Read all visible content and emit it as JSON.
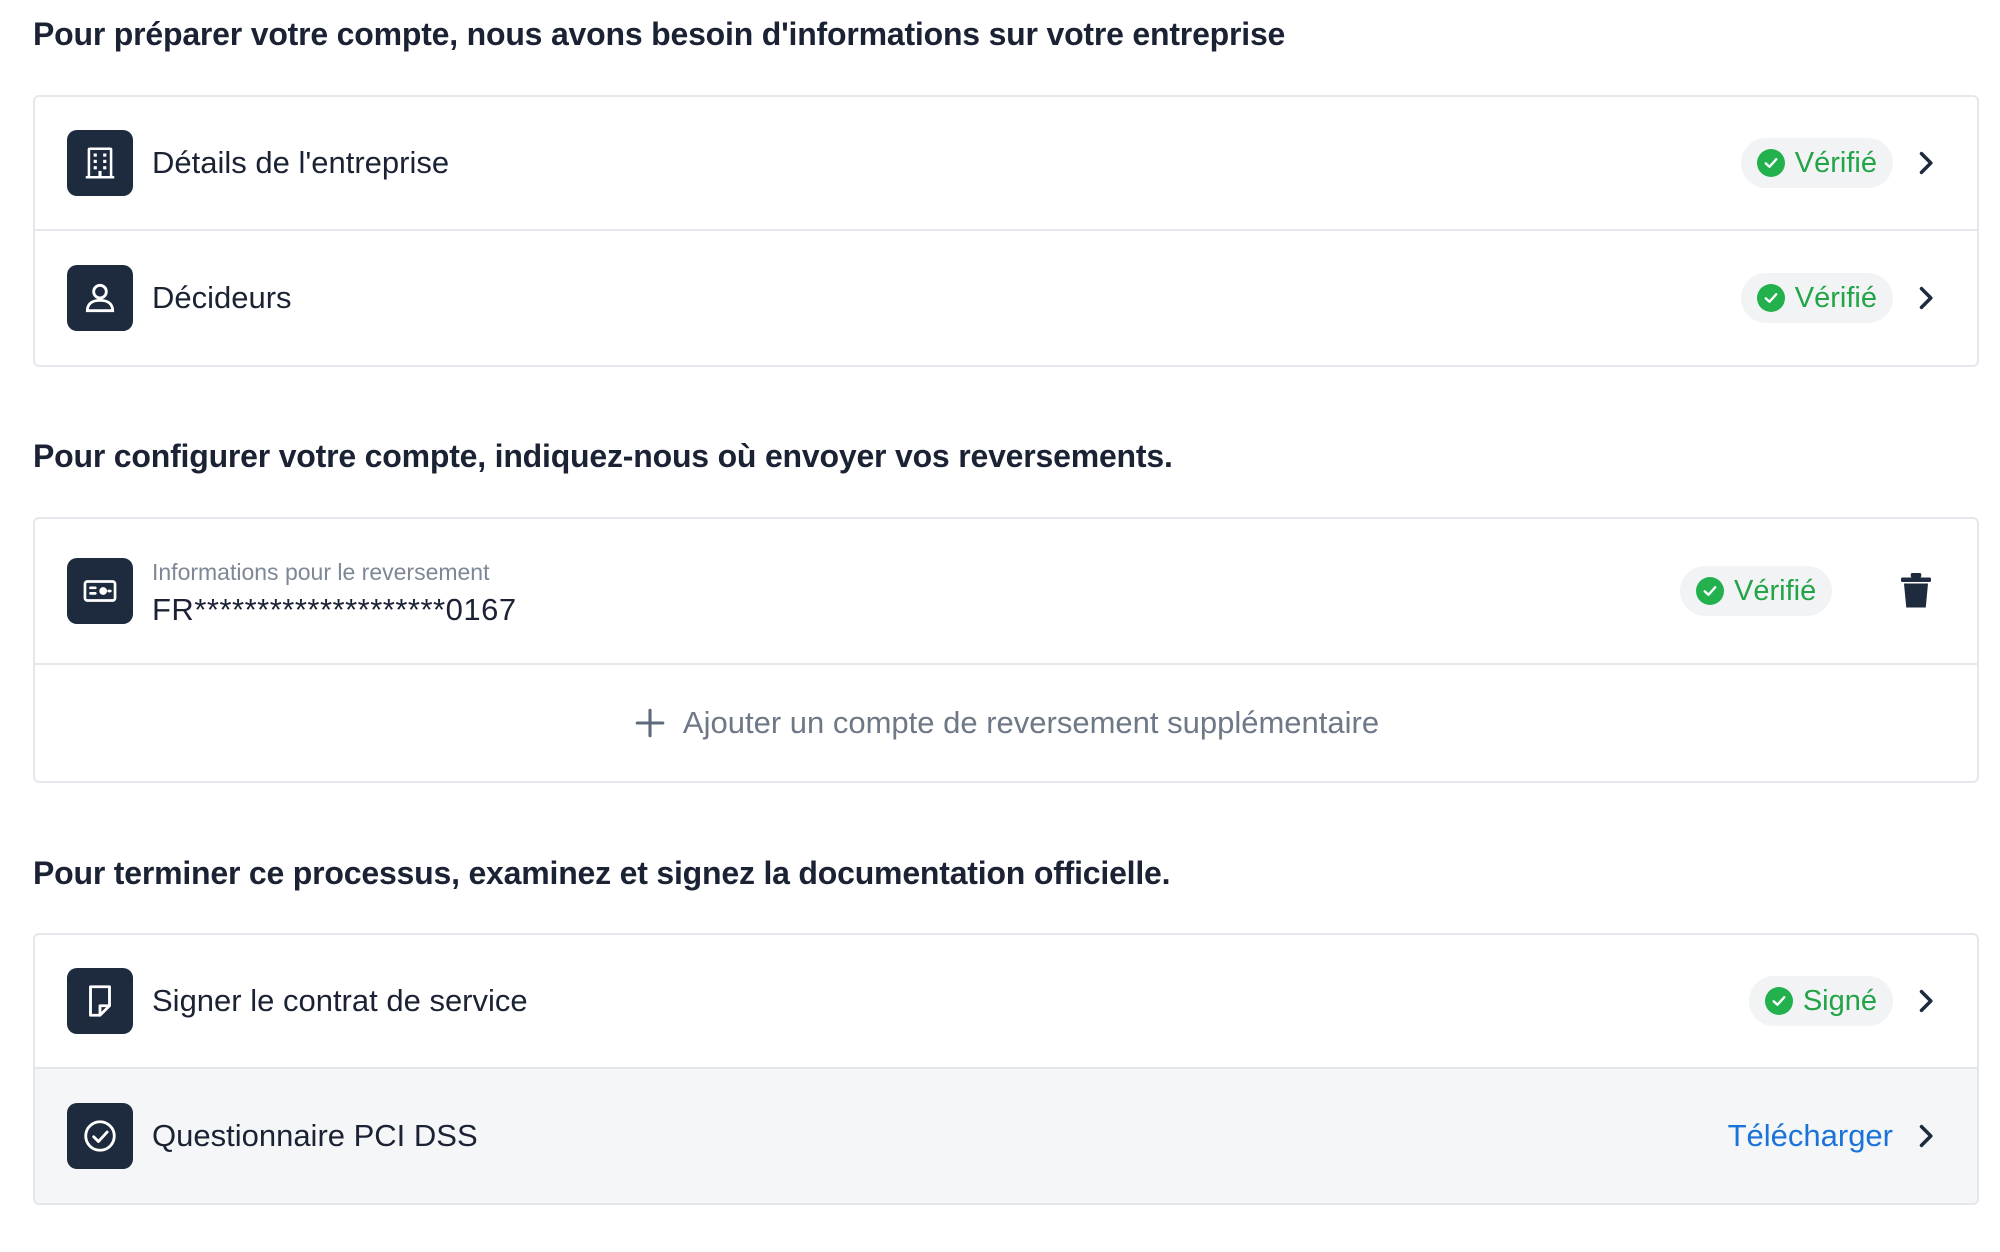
{
  "section1": {
    "heading": "Pour préparer votre compte, nous avons besoin d'informations sur votre entreprise",
    "rows": [
      {
        "label": "Détails de l'entreprise",
        "icon": "building-icon",
        "status": "Vérifié"
      },
      {
        "label": "Décideurs",
        "icon": "person-icon",
        "status": "Vérifié"
      }
    ]
  },
  "section2": {
    "heading": "Pour configurer votre compte, indiquez-nous où envoyer vos reversements.",
    "payout": {
      "caption": "Informations pour le reversement",
      "iban": "FR********************0167",
      "icon": "banknote-icon",
      "status": "Vérifié"
    },
    "add_label": "Ajouter un compte de reversement supplémentaire"
  },
  "section3": {
    "heading": "Pour terminer ce processus, examinez et signez la documentation officielle.",
    "rows": [
      {
        "label": "Signer le contrat de service",
        "icon": "document-icon",
        "status": "Signé"
      },
      {
        "label": "Questionnaire PCI DSS",
        "icon": "check-circle-icon",
        "action": "Télécharger"
      }
    ]
  },
  "colors": {
    "icon_bg": "#1e2a3e",
    "verified_text": "#22a447",
    "verified_dot": "#22b14c",
    "link": "#1a73d9",
    "border": "#e4e7ec"
  }
}
